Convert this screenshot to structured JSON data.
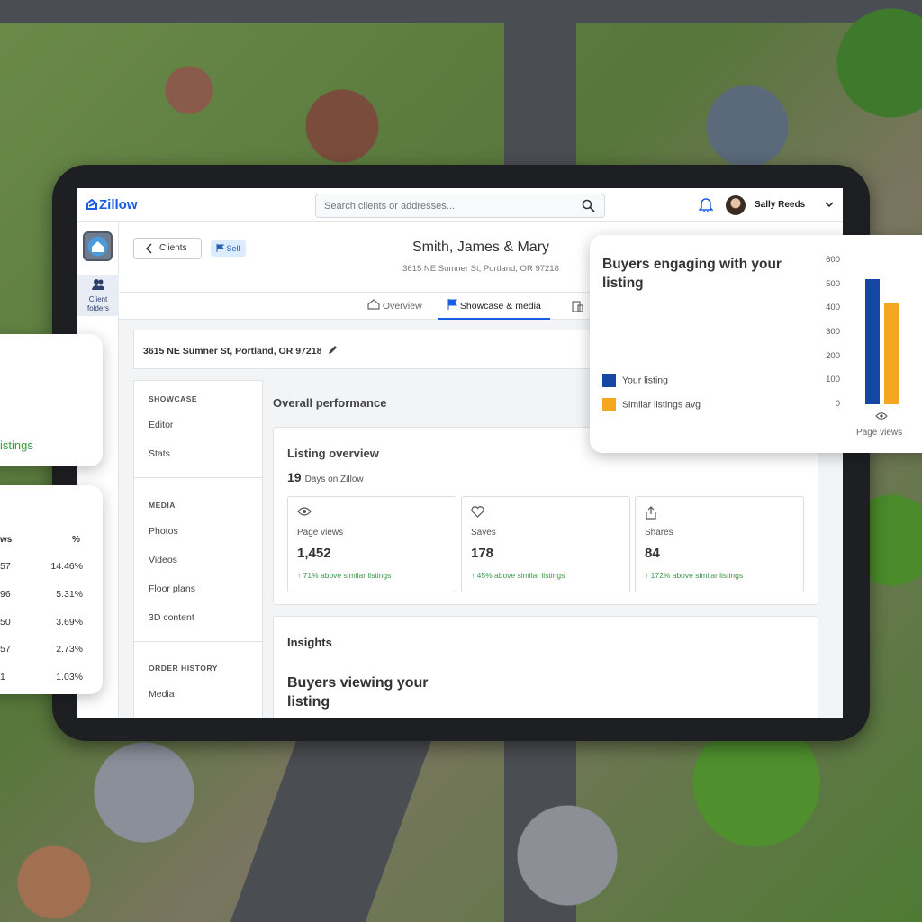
{
  "app": {
    "logo": "Zillow",
    "search_placeholder": "Search clients or addresses...",
    "user_name": "Sally Reeds"
  },
  "rail": {
    "client_folders_1": "Client",
    "client_folders_2": "folders"
  },
  "header": {
    "back_label": "Clients",
    "badge": "Sell",
    "client_name": "Smith, James & Mary",
    "address": "3615 NE Sumner St, Portland, OR 97218"
  },
  "tabs": [
    {
      "label": "Overview"
    },
    {
      "label": "Showcase & media"
    }
  ],
  "address_bar": "3615 NE Sumner St, Portland, OR 97218",
  "subnav": {
    "showcase_heading": "SHOWCASE",
    "editor": "Editor",
    "stats": "Stats",
    "media_heading": "MEDIA",
    "photos": "Photos",
    "videos": "Videos",
    "floor_plans": "Floor plans",
    "content_3d": "3D content",
    "order_heading": "ORDER HISTORY",
    "order_media": "Media"
  },
  "main": {
    "overall": "Overall performance",
    "listing_overview": "Listing overview",
    "days_value": "19",
    "days_label": "Days on Zillow",
    "stats": [
      {
        "label": "Page views",
        "value": "1,452",
        "delta": "↑ 71% above similar listings"
      },
      {
        "label": "Saves",
        "value": "178",
        "delta": "↑ 45% above similar listings"
      },
      {
        "label": "Shares",
        "value": "84",
        "delta": "↑ 172% above similar listings"
      }
    ],
    "insights": "Insights",
    "buyers_viewing": "Buyers viewing your listing"
  },
  "chart_data": {
    "type": "bar",
    "title": "Buyers engaging with your listing",
    "categories": [
      "Page views"
    ],
    "series": [
      {
        "name": "Your listing",
        "values": [
          520
        ],
        "color": "#1646a4"
      },
      {
        "name": "Similar listings avg",
        "values": [
          420
        ],
        "color": "#f4a620"
      }
    ],
    "ylim": [
      0,
      600
    ],
    "yticks": [
      "600",
      "500",
      "400",
      "300",
      "200",
      "100",
      "0"
    ],
    "legend": "left"
  },
  "card_left_1": {
    "text": "istings"
  },
  "card_left_2": {
    "col1": "ws",
    "col2": "%",
    "rows": [
      {
        "a": "57",
        "b": "14.46%"
      },
      {
        "a": "96",
        "b": "5.31%"
      },
      {
        "a": "50",
        "b": "3.69%"
      },
      {
        "a": "57",
        "b": "2.73%"
      },
      {
        "a": "1",
        "b": "1.03%"
      }
    ]
  },
  "colors": {
    "brand": "#1a5ee0",
    "positive": "#3a9a4a",
    "your_listing": "#1646a4",
    "similar": "#f4a620"
  }
}
